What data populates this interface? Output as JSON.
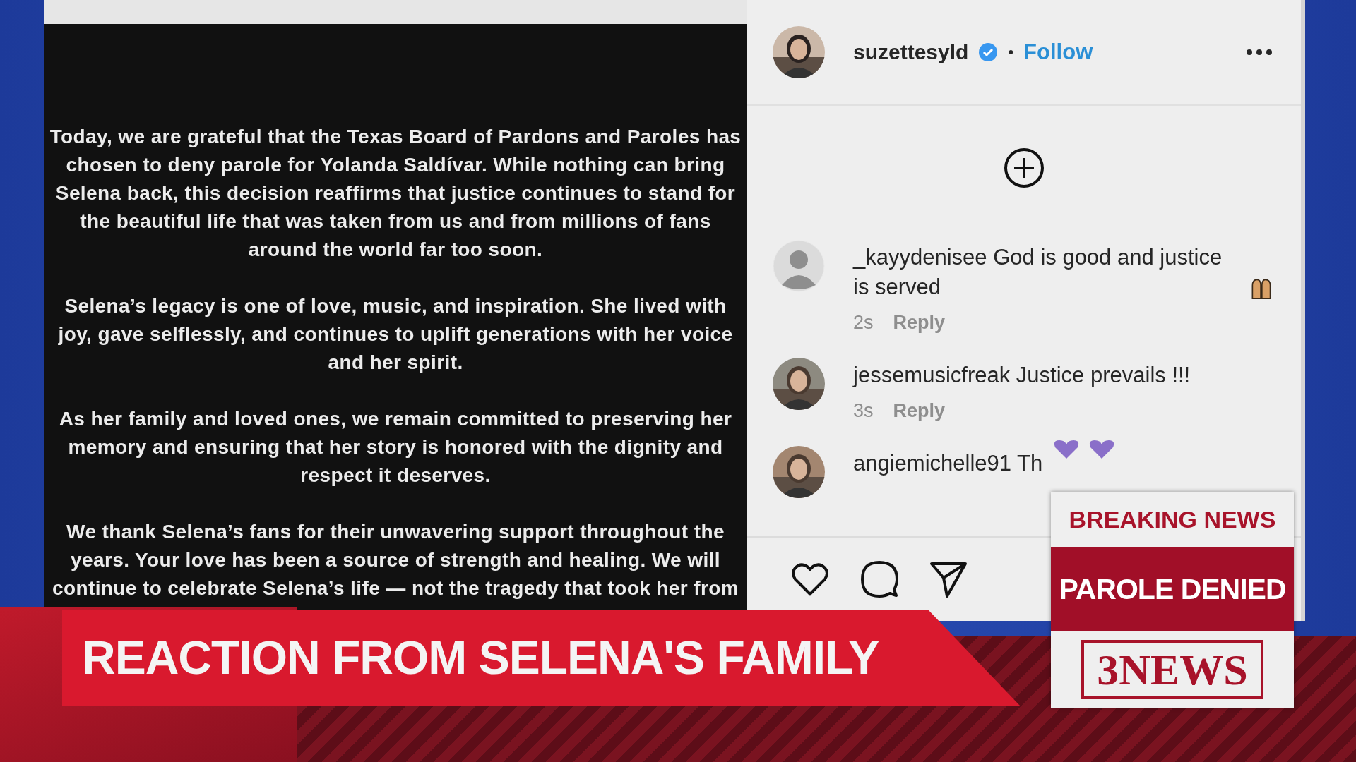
{
  "post_image": {
    "paragraphs": [
      "Today, we are grateful that the Texas Board of Pardons and Paroles has chosen to deny parole for Yolanda Saldívar. While nothing can bring Selena back, this decision reaffirms that justice continues to stand for the beautiful life that was taken from us and from millions of fans around the world far too soon.",
      "Selena’s legacy is one of love, music, and inspiration. She lived with joy, gave selflessly, and continues to uplift generations with her voice and her spirit.",
      "As her family and loved ones, we remain committed to preserving her memory and ensuring that her story is honored with the dignity and respect it deserves.",
      "We thank Selena’s fans for their unwavering support throughout the years. Your love has been a source of strength and healing. We will continue to celebrate Selena’s life — not the tragedy that took her from"
    ]
  },
  "header": {
    "username": "suzettesyld",
    "verified": true,
    "separator": "•",
    "follow": "Follow"
  },
  "comments": [
    {
      "avatar": {
        "kind": "placeholder"
      },
      "username": "_kayydenisee",
      "text": "God is good and justice is served",
      "emoji": {
        "kind": "hands"
      },
      "time": "2s",
      "reply": "Reply"
    },
    {
      "username": "jessemusicfreak",
      "text": "Justice prevails !!!",
      "time": "3s",
      "reply": "Reply"
    },
    {
      "username": "angiemichelle91",
      "text": "Th",
      "emoji": {
        "kind": "hearts"
      }
    }
  ],
  "lower_third": {
    "headline": "REACTION FROM SELENA'S FAMILY"
  },
  "breaking_box": {
    "label": "BREAKING NEWS",
    "headline": "PAROLE DENIED",
    "logo": "3NEWS"
  }
}
